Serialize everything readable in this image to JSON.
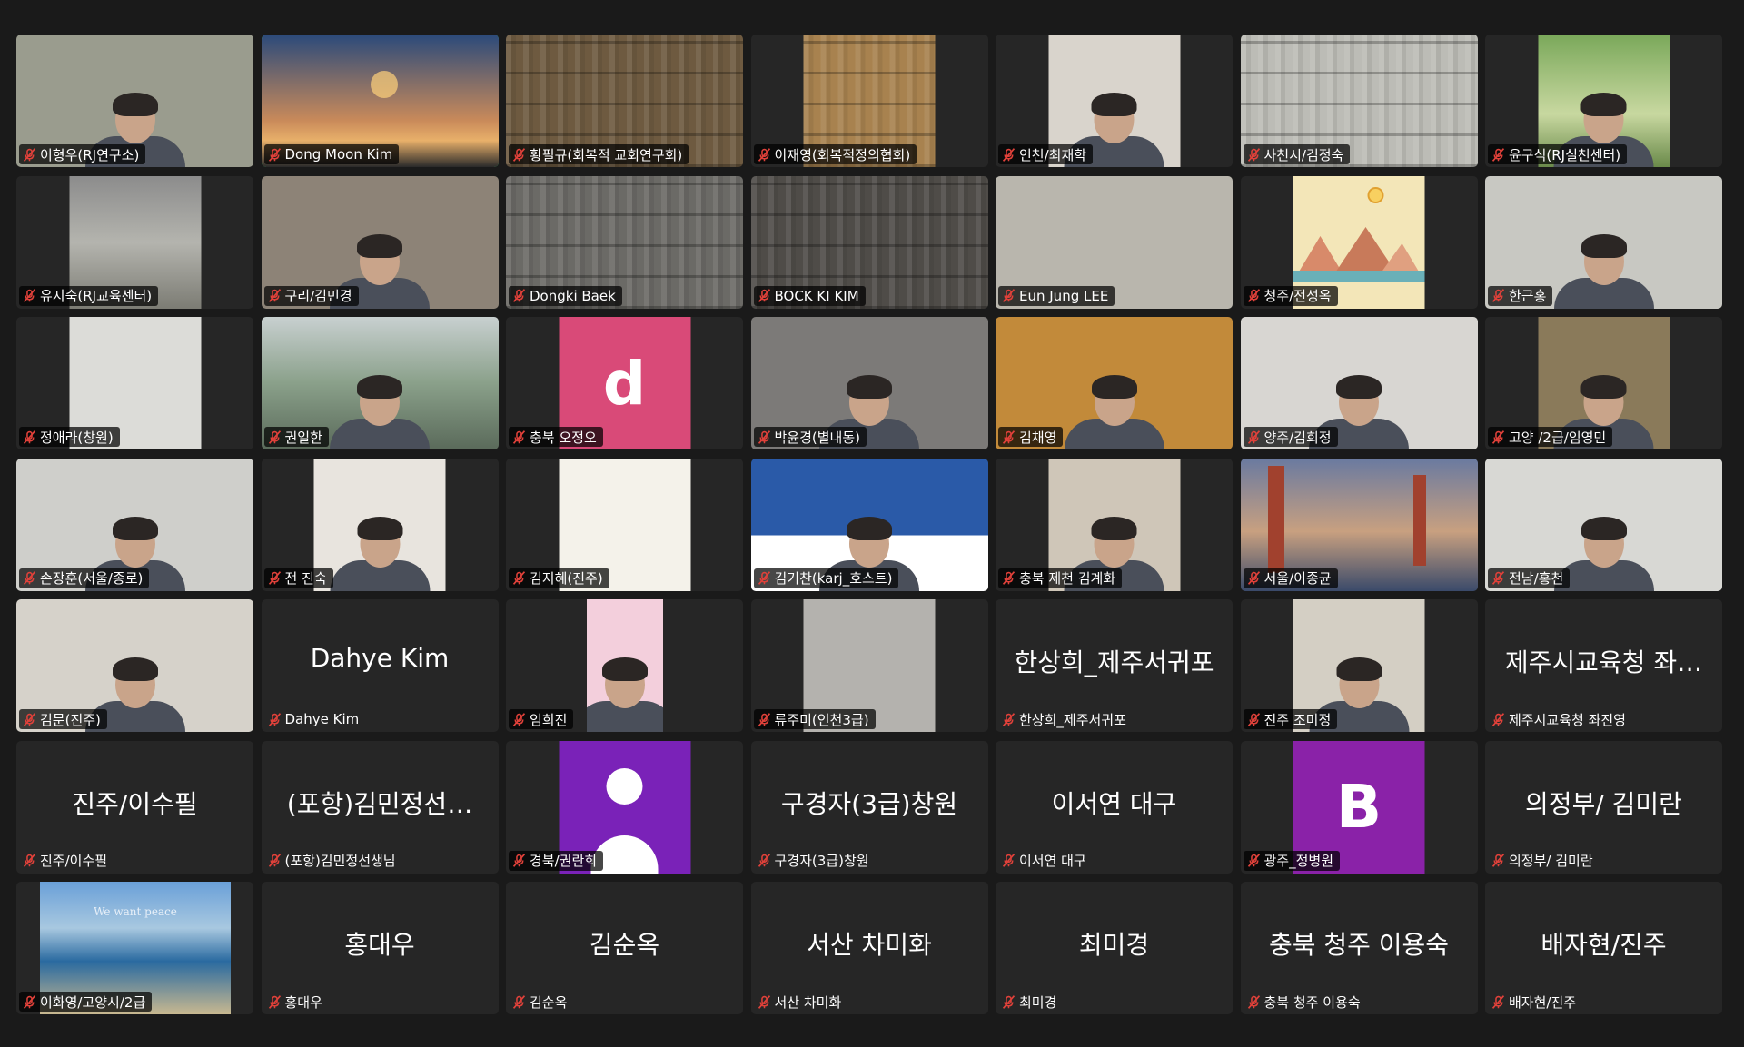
{
  "participants": [
    {
      "name": "이형우(RJ연구소)",
      "kind": "video",
      "bg": "#9a9c8e",
      "fit": "wide",
      "art": "person"
    },
    {
      "name": "Dong Moon Kim",
      "kind": "video",
      "bg": "linear-gradient(180deg,#2b4a7a 0%,#c98a5a 65%,#e8b06a 80%,#2a2a2a 100%)",
      "fit": "wide",
      "active": true,
      "art": "sunset"
    },
    {
      "name": "황필규(회복적 교회연구회)",
      "kind": "video",
      "bg": "#6e5a40",
      "fit": "wide",
      "art": "books"
    },
    {
      "name": "이재영(회복적정의협회)",
      "kind": "video",
      "bg": "#a8824f",
      "fit": "narrow",
      "art": "books"
    },
    {
      "name": "인천/최재학",
      "kind": "video",
      "bg": "#d9d4cc",
      "fit": "narrow",
      "art": "person"
    },
    {
      "name": "사천시/김정숙",
      "kind": "video",
      "bg": "#bcbcb6",
      "fit": "wide",
      "art": "books"
    },
    {
      "name": "윤구식(RJ실천센터)",
      "kind": "video",
      "bg": "linear-gradient(180deg,#7aa85a 0%,#c8d8a0 60%,#6a8a4a 100%)",
      "fit": "narrow",
      "art": "person"
    },
    {
      "name": "유지숙(RJ교육센터)",
      "kind": "video",
      "bg": "linear-gradient(180deg,#8c8c8c 0%,#b4b4ae 50%,#7c7c74 100%)",
      "fit": "narrow",
      "art": "none"
    },
    {
      "name": "구리/김민경",
      "kind": "video",
      "bg": "#8d8377",
      "fit": "wide",
      "art": "person"
    },
    {
      "name": "Dongki Baek",
      "kind": "video",
      "bg": "#6b6a66",
      "fit": "wide",
      "art": "books"
    },
    {
      "name": "BOCK KI KIM",
      "kind": "video",
      "bg": "#4f4c48",
      "fit": "wide",
      "art": "books"
    },
    {
      "name": "Eun Jung LEE",
      "kind": "video",
      "bg": "#b9b6ad",
      "fit": "wide",
      "art": "none"
    },
    {
      "name": "청주/전성옥",
      "kind": "video",
      "bg": "#f3e6b8",
      "fit": "narrow",
      "art": "mountain"
    },
    {
      "name": "한근홍",
      "kind": "video",
      "bg": "#c8c8c2",
      "fit": "wide",
      "art": "person"
    },
    {
      "name": "정애라(창원)",
      "kind": "video",
      "bg": "#dcdcd8",
      "fit": "narrow",
      "art": "none"
    },
    {
      "name": "권일한",
      "kind": "video",
      "bg": "linear-gradient(180deg,#c8d0d0 0%,#8aa08a 50%,#5a6a5a 100%)",
      "fit": "wide",
      "art": "person"
    },
    {
      "name": "충북 오정오",
      "kind": "letter",
      "letter": "d",
      "color": "#d94a78"
    },
    {
      "name": "박윤경(별내동)",
      "kind": "video",
      "bg": "#7c7a78",
      "fit": "wide",
      "art": "person"
    },
    {
      "name": "김채영",
      "kind": "video",
      "bg": "#c28a3a",
      "fit": "wide",
      "art": "person"
    },
    {
      "name": "양주/김희정",
      "kind": "video",
      "bg": "#d8d6d2",
      "fit": "wide",
      "art": "person"
    },
    {
      "name": "고양 /2급/임영민",
      "kind": "video",
      "bg": "#8a7a5a",
      "fit": "narrow",
      "art": "person"
    },
    {
      "name": "손장훈(서울/종로)",
      "kind": "video",
      "bg": "#cfcfcb",
      "fit": "wide",
      "art": "person"
    },
    {
      "name": "전 진숙",
      "kind": "video",
      "bg": "#e8e4de",
      "fit": "narrow",
      "art": "person"
    },
    {
      "name": "김지혜(진주)",
      "kind": "video",
      "bg": "#f4f2ea",
      "fit": "narrow",
      "art": "none"
    },
    {
      "name": "김기찬(karj_호스트)",
      "kind": "video",
      "bg": "linear-gradient(180deg,#2a5aa8 0%,#2a5aa8 58%,#ffffff 58%)",
      "fit": "wide",
      "art": "person"
    },
    {
      "name": "충북 제천 김계화",
      "kind": "video",
      "bg": "#cfc6b8",
      "fit": "narrow",
      "art": "person"
    },
    {
      "name": "서울/이종균",
      "kind": "video",
      "bg": "linear-gradient(180deg,#6a7aa0 0%,#c8a080 55%,#3a4a6a 100%)",
      "fit": "wide",
      "art": "bridge"
    },
    {
      "name": "전남/홍천",
      "kind": "video",
      "bg": "#d8d8d4",
      "fit": "wide",
      "art": "person"
    },
    {
      "name": "김문(진주)",
      "kind": "video",
      "bg": "#d6d2ca",
      "fit": "wide",
      "art": "person"
    },
    {
      "name": "Dahye Kim",
      "kind": "text",
      "big": "Dahye Kim"
    },
    {
      "name": "임희진",
      "kind": "video",
      "bg": "#f3cfdc",
      "fit": "slim",
      "art": "person"
    },
    {
      "name": "류주미(인천3급)",
      "kind": "video",
      "bg": "#b4b2ae",
      "fit": "narrow",
      "art": "none"
    },
    {
      "name": "한상희_제주서귀포",
      "kind": "text",
      "big": "한상희_제주서귀포"
    },
    {
      "name": "진주 조미정",
      "kind": "video",
      "bg": "#d4cfc4",
      "fit": "narrow",
      "art": "person"
    },
    {
      "name": "제주시교육청 좌진영",
      "kind": "text",
      "big": "제주시교육청 좌…"
    },
    {
      "name": "진주/이수필",
      "kind": "text",
      "big": "진주/이수필"
    },
    {
      "name": "(포항)김민정선생님",
      "kind": "text",
      "big": "(포항)김민정선…"
    },
    {
      "name": "경북/권란희",
      "kind": "avatar",
      "color": "#7a22b8"
    },
    {
      "name": "구경자(3급)창원",
      "kind": "text",
      "big": "구경자(3급)창원"
    },
    {
      "name": "이서연 대구",
      "kind": "text",
      "big": "이서연 대구"
    },
    {
      "name": "광주_정병원",
      "kind": "letter",
      "letter": "B",
      "color": "#8a22a8"
    },
    {
      "name": "의정부/ 김미란",
      "kind": "text",
      "big": "의정부/ 김미란"
    },
    {
      "name": "이화영/고양시/2급",
      "kind": "video",
      "bg": "linear-gradient(180deg,#6aa0d8 0%,#a8c8e0 35%,#2a6aa0 60%,#c8b890 100%)",
      "fit": "narrow2",
      "art": "peace",
      "caption": "We want peace"
    },
    {
      "name": "홍대우",
      "kind": "text",
      "big": "홍대우"
    },
    {
      "name": "김순옥",
      "kind": "text",
      "big": "김순옥"
    },
    {
      "name": "서산 차미화",
      "kind": "text",
      "big": "서산 차미화"
    },
    {
      "name": "최미경",
      "kind": "text",
      "big": "최미경"
    },
    {
      "name": "충북 청주 이용숙",
      "kind": "text",
      "big": "충북 청주 이용숙"
    },
    {
      "name": "배자현/진주",
      "kind": "text",
      "big": "배자현/진주"
    }
  ],
  "colors": {
    "background": "#1a1a1a",
    "tile": "#262626",
    "active_speaker": "#3ddc6a",
    "muted_mic": "#e0413a"
  },
  "icons": {
    "muted": "mic-off-icon"
  }
}
